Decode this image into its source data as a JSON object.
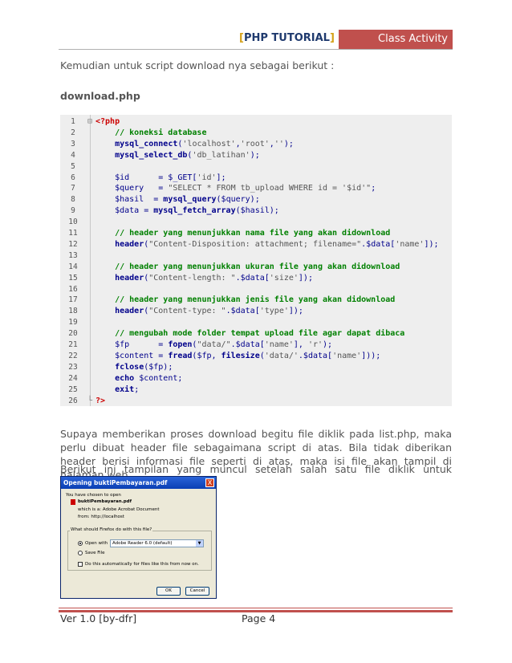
{
  "header": {
    "bracket_open": "[",
    "title": "PHP TUTORIAL",
    "bracket_close": "]",
    "badge": "Class Activity"
  },
  "intro": "Kemudian untuk script download nya sebagai berikut :",
  "filename": "download.php",
  "code_lines": [
    {
      "n": "1",
      "src": "<?php"
    },
    {
      "n": "2",
      "src": "    // koneksi database"
    },
    {
      "n": "3",
      "src": "    mysql_connect('localhost','root','');"
    },
    {
      "n": "4",
      "src": "    mysql_select_db('db_latihan');"
    },
    {
      "n": "5",
      "src": ""
    },
    {
      "n": "6",
      "src": "    $id      = $_GET['id'];"
    },
    {
      "n": "7",
      "src": "    $query   = \"SELECT * FROM tb_upload WHERE id = '$id'\";"
    },
    {
      "n": "8",
      "src": "    $hasil  = mysql_query($query);"
    },
    {
      "n": "9",
      "src": "    $data = mysql_fetch_array($hasil);"
    },
    {
      "n": "10",
      "src": ""
    },
    {
      "n": "11",
      "src": "    // header yang menunjukkan nama file yang akan didownload"
    },
    {
      "n": "12",
      "src": "    header(\"Content-Disposition: attachment; filename=\".$data['name']);"
    },
    {
      "n": "13",
      "src": ""
    },
    {
      "n": "14",
      "src": "    // header yang menunjukkan ukuran file yang akan didownload"
    },
    {
      "n": "15",
      "src": "    header(\"Content-length: \".$data['size']);"
    },
    {
      "n": "16",
      "src": ""
    },
    {
      "n": "17",
      "src": "    // header yang menunjukkan jenis file yang akan didownload"
    },
    {
      "n": "18",
      "src": "    header(\"Content-type: \".$data['type']);"
    },
    {
      "n": "19",
      "src": ""
    },
    {
      "n": "20",
      "src": "    // mengubah mode folder tempat upload file agar dapat dibaca"
    },
    {
      "n": "21",
      "src": "    $fp      = fopen(\"data/\".$data['name'], 'r');"
    },
    {
      "n": "22",
      "src": "    $content = fread($fp, filesize('data/'.$data['name']));"
    },
    {
      "n": "23",
      "src": "    fclose($fp);"
    },
    {
      "n": "24",
      "src": "    echo $content;"
    },
    {
      "n": "25",
      "src": "    exit;"
    },
    {
      "n": "26",
      "src": "?>"
    }
  ],
  "para1": "Supaya memberikan proses download begitu file diklik pada list.php, maka perlu dibuat header file sebagaimana script di atas. Bila tidak diberikan header berisi informasi file seperti di atas, maka isi file akan tampil di halaman web.",
  "para2": "Berikut ini tampilan yang muncul setelah salah satu file diklik untuk didownload",
  "dialog": {
    "title": "Opening buktiPembayaran.pdf",
    "close": "X",
    "chosen": "You have chosen to open",
    "file": "buktiPembayaran.pdf",
    "which_is": "which is a:  Adobe Acrobat Document",
    "from": "from:  http://localhost",
    "question": "What should Firefox do with this file?",
    "open_with": "Open with",
    "open_with_value": "Adobe Reader 6.0 (default)",
    "save_file": "Save File",
    "auto": "Do this automatically for files like this from now on.",
    "ok": "OK",
    "cancel": "Cancel"
  },
  "footer": {
    "version": "Ver 1.0 [by-dfr]",
    "page": "Page 4"
  }
}
